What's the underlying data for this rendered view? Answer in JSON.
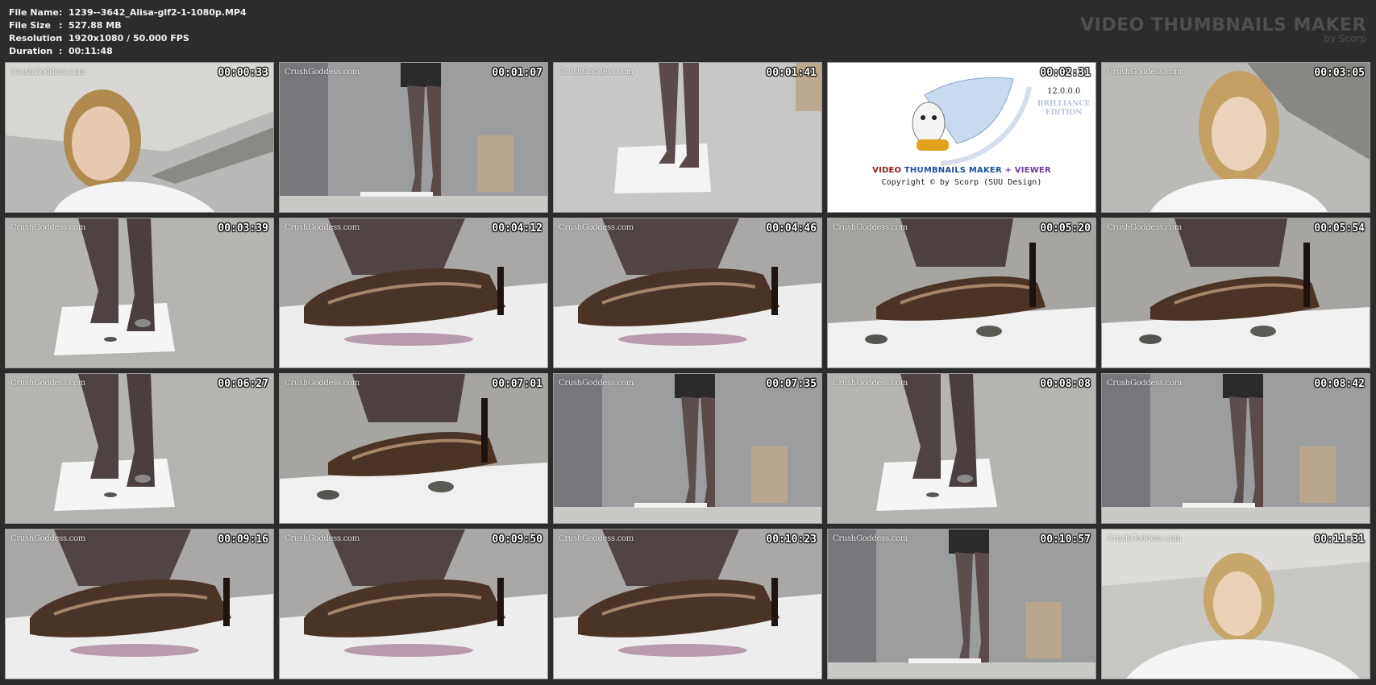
{
  "header": {
    "file_name_label": "File Name",
    "file_name": "1239--3642_Alisa-glf2-1-1080p.MP4",
    "file_size_label": "File Size",
    "file_size": "527.88 MB",
    "resolution_label": "Resolution",
    "resolution": "1920x1080 / 50.000 FPS",
    "duration_label": "Duration",
    "duration": "00:11:48",
    "separator": ":"
  },
  "brand": {
    "title": "VIDEO THUMBNAILS MAKER",
    "subtitle": "by Scorp"
  },
  "watermark": "CrushGoddess.com",
  "logo": {
    "version": "12.0.0.0",
    "edition_line1": "BRILLIANCE",
    "edition_line2": "EDITION",
    "title_part1": "VIDEO",
    "title_part2": "THUMBNAILS MAKER",
    "title_part3": "+ VIEWER",
    "copyright": "Copyright © by Scorp (SUU Design)"
  },
  "thumbnails": [
    {
      "time": "00:00:33",
      "scene": "face"
    },
    {
      "time": "00:01:07",
      "scene": "legs-room"
    },
    {
      "time": "00:01:41",
      "scene": "legs-paper"
    },
    {
      "time": "00:02:31",
      "scene": "logo"
    },
    {
      "time": "00:03:05",
      "scene": "face2"
    },
    {
      "time": "00:03:39",
      "scene": "feet-paper"
    },
    {
      "time": "00:04:12",
      "scene": "shoe-close"
    },
    {
      "time": "00:04:46",
      "scene": "shoe-close"
    },
    {
      "time": "00:05:20",
      "scene": "shoe-fish"
    },
    {
      "time": "00:05:54",
      "scene": "shoe-fish"
    },
    {
      "time": "00:06:27",
      "scene": "feet-paper"
    },
    {
      "time": "00:07:01",
      "scene": "shoe-fish"
    },
    {
      "time": "00:07:35",
      "scene": "legs-room"
    },
    {
      "time": "00:08:08",
      "scene": "feet-paper"
    },
    {
      "time": "00:08:42",
      "scene": "legs-room"
    },
    {
      "time": "00:09:16",
      "scene": "shoe-close"
    },
    {
      "time": "00:09:50",
      "scene": "shoe-close"
    },
    {
      "time": "00:10:23",
      "scene": "shoe-close"
    },
    {
      "time": "00:10:57",
      "scene": "legs-room"
    },
    {
      "time": "00:11:31",
      "scene": "face3"
    }
  ]
}
